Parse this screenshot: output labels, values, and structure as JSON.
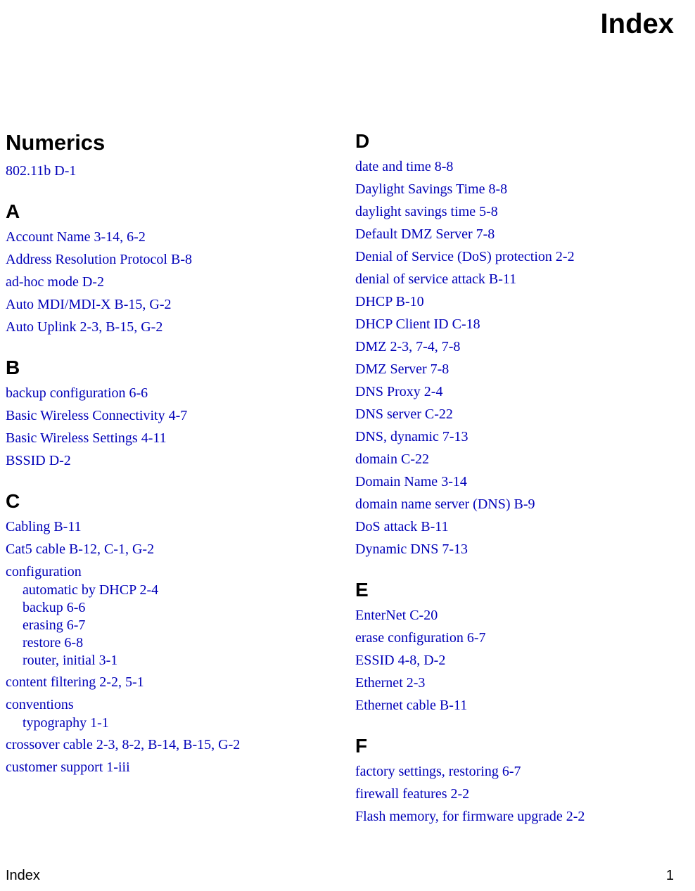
{
  "title": "Index",
  "footer": {
    "left": "Index",
    "right": "1"
  },
  "left": {
    "numerics_heading": "Numerics",
    "numerics": [
      "802.11b  D-1"
    ],
    "a_heading": "A",
    "a": [
      "Account Name  3-14, 6-2",
      "Address Resolution Protocol  B-8",
      "ad-hoc mode  D-2",
      "Auto MDI/MDI-X  B-15, G-2",
      "Auto Uplink  2-3, B-15, G-2"
    ],
    "b_heading": "B",
    "b": [
      "backup configuration  6-6",
      "Basic Wireless Connectivity  4-7",
      "Basic Wireless Settings  4-11",
      "BSSID  D-2"
    ],
    "c_heading": "C",
    "c1": [
      "Cabling  B-11",
      "Cat5 cable  B-12, C-1, G-2"
    ],
    "c_config_label": "configuration",
    "c_config_sub": [
      "automatic by DHCP  2-4",
      "backup  6-6",
      "erasing  6-7",
      "restore  6-8",
      "router, initial  3-1"
    ],
    "c2": [
      "content filtering  2-2, 5-1"
    ],
    "c_conv_label": "conventions",
    "c_conv_sub": [
      "typography  1-1"
    ],
    "c3": [
      "crossover cable  2-3, 8-2, B-14, B-15, G-2",
      "customer support  1-iii"
    ]
  },
  "right": {
    "d_heading": "D",
    "d": [
      "date and time  8-8",
      "Daylight Savings Time  8-8",
      "daylight savings time  5-8",
      "Default DMZ Server  7-8",
      "Denial of Service (DoS) protection  2-2",
      "denial of service attack  B-11",
      "DHCP  B-10",
      "DHCP Client ID  C-18",
      "DMZ  2-3, 7-4, 7-8",
      "DMZ Server  7-8",
      "DNS Proxy  2-4",
      "DNS server  C-22",
      "DNS, dynamic  7-13",
      "domain  C-22",
      "Domain Name  3-14",
      "domain name server (DNS)  B-9",
      "DoS attack  B-11",
      "Dynamic DNS  7-13"
    ],
    "e_heading": "E",
    "e": [
      "EnterNet  C-20",
      "erase configuration  6-7",
      "ESSID  4-8, D-2",
      "Ethernet  2-3",
      "Ethernet cable  B-11"
    ],
    "f_heading": "F",
    "f": [
      "factory settings, restoring  6-7",
      "firewall features  2-2",
      "Flash memory, for firmware upgrade  2-2"
    ]
  }
}
